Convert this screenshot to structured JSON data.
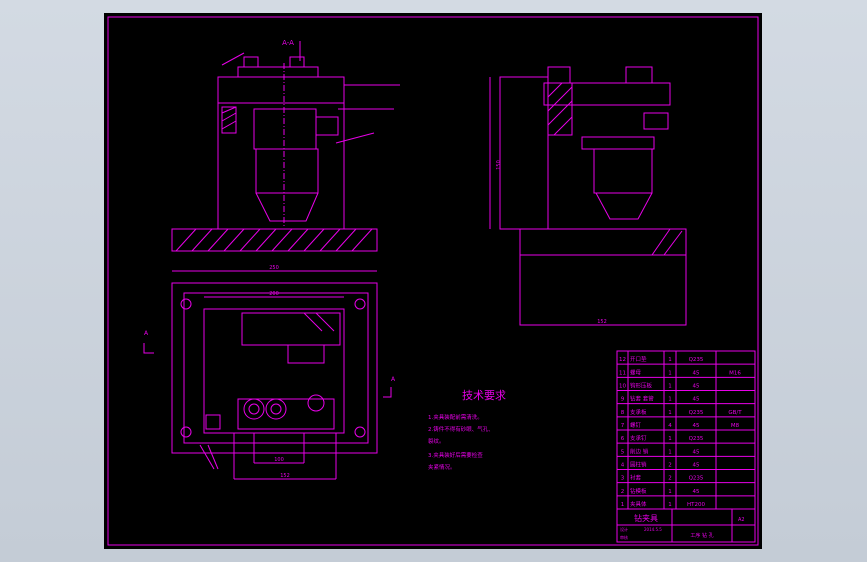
{
  "colors": {
    "paper": "#000000",
    "line": "#e800e8",
    "background": "#c9d0d9"
  },
  "top_view_dims": {
    "overall_width": "250",
    "inner_width": "200",
    "bottom_a": "100",
    "bottom_b": "152"
  },
  "side_view_dims": {
    "height": "150",
    "base": "152"
  },
  "section_marks": {
    "a_left": "A",
    "a_right": "A",
    "aa": "A-A"
  },
  "tech_requirements": {
    "title": "技术要求",
    "lines": [
      "1.夹具装配前需清洗。",
      "2.铸件不得有砂眼、气孔、",
      "裂纹。",
      "3.夹具装好后需要检查",
      "夹紧情况。"
    ]
  },
  "parts_list": {
    "rows": [
      {
        "no": "12",
        "name": "开口垫",
        "qty": "1",
        "material": "Q235",
        "note": ""
      },
      {
        "no": "11",
        "name": "螺母",
        "qty": "1",
        "material": "45",
        "note": "M16"
      },
      {
        "no": "10",
        "name": "钩形压板",
        "qty": "1",
        "material": "45",
        "note": ""
      },
      {
        "no": "9",
        "name": "钻套 套管",
        "qty": "1",
        "material": "45",
        "note": ""
      },
      {
        "no": "8",
        "name": "支承板",
        "qty": "1",
        "material": "Q235",
        "note": "GB/T"
      },
      {
        "no": "7",
        "name": "螺钉",
        "qty": "4",
        "material": "45",
        "note": "M8"
      },
      {
        "no": "6",
        "name": "支承钉",
        "qty": "1",
        "material": "Q235",
        "note": ""
      },
      {
        "no": "5",
        "name": "削边 销",
        "qty": "1",
        "material": "45",
        "note": ""
      },
      {
        "no": "4",
        "name": "圆柱销",
        "qty": "2",
        "material": "45",
        "note": ""
      },
      {
        "no": "3",
        "name": "衬套",
        "qty": "2",
        "material": "Q235",
        "note": ""
      },
      {
        "no": "2",
        "name": "钻模板",
        "qty": "1",
        "material": "45",
        "note": ""
      },
      {
        "no": "1",
        "name": "夹具体",
        "qty": "1",
        "material": "HT200",
        "note": ""
      }
    ]
  },
  "title_block": {
    "title": "钻夹具",
    "designer": "设计",
    "checker": "审核",
    "date": "2014.5.5",
    "sheet_size": "A2",
    "drawing_no": "工序 钻 孔"
  }
}
